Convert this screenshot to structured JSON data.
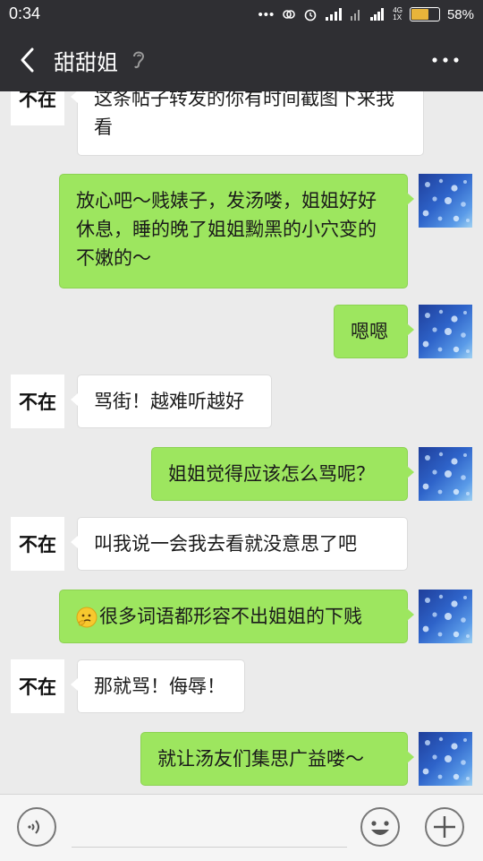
{
  "status_bar": {
    "time": "0:34",
    "network": "4G",
    "network_sub": "1X",
    "battery": "58%"
  },
  "header": {
    "title": "甜甜姐"
  },
  "contact": {
    "avatar_text": "不在"
  },
  "messages": [
    {
      "side": "in",
      "text": "这条帖子转发的你有时间截图下来我看"
    },
    {
      "side": "out",
      "text": "放心吧～贱婊子，发汤喽，姐姐好好休息，睡的晚了姐姐黝黑的小穴变的不嫩的～"
    },
    {
      "side": "out",
      "text": "嗯嗯"
    },
    {
      "side": "in",
      "text": "骂街！越难听越好"
    },
    {
      "side": "out",
      "text": "姐姐觉得应该怎么骂呢？"
    },
    {
      "side": "in",
      "text": "叫我说一会我去看就没意思了吧"
    },
    {
      "side": "out",
      "text": "很多词语都形容不出姐姐的下贱",
      "emoji": "thinking-face"
    },
    {
      "side": "in",
      "text": "那就骂！侮辱！"
    },
    {
      "side": "out",
      "text": "就让汤友们集思广益喽～"
    }
  ],
  "colors": {
    "header_bg": "#2f2f33",
    "chat_bg": "#ebebeb",
    "bubble_out": "#9de65f",
    "bubble_in": "#ffffff"
  }
}
